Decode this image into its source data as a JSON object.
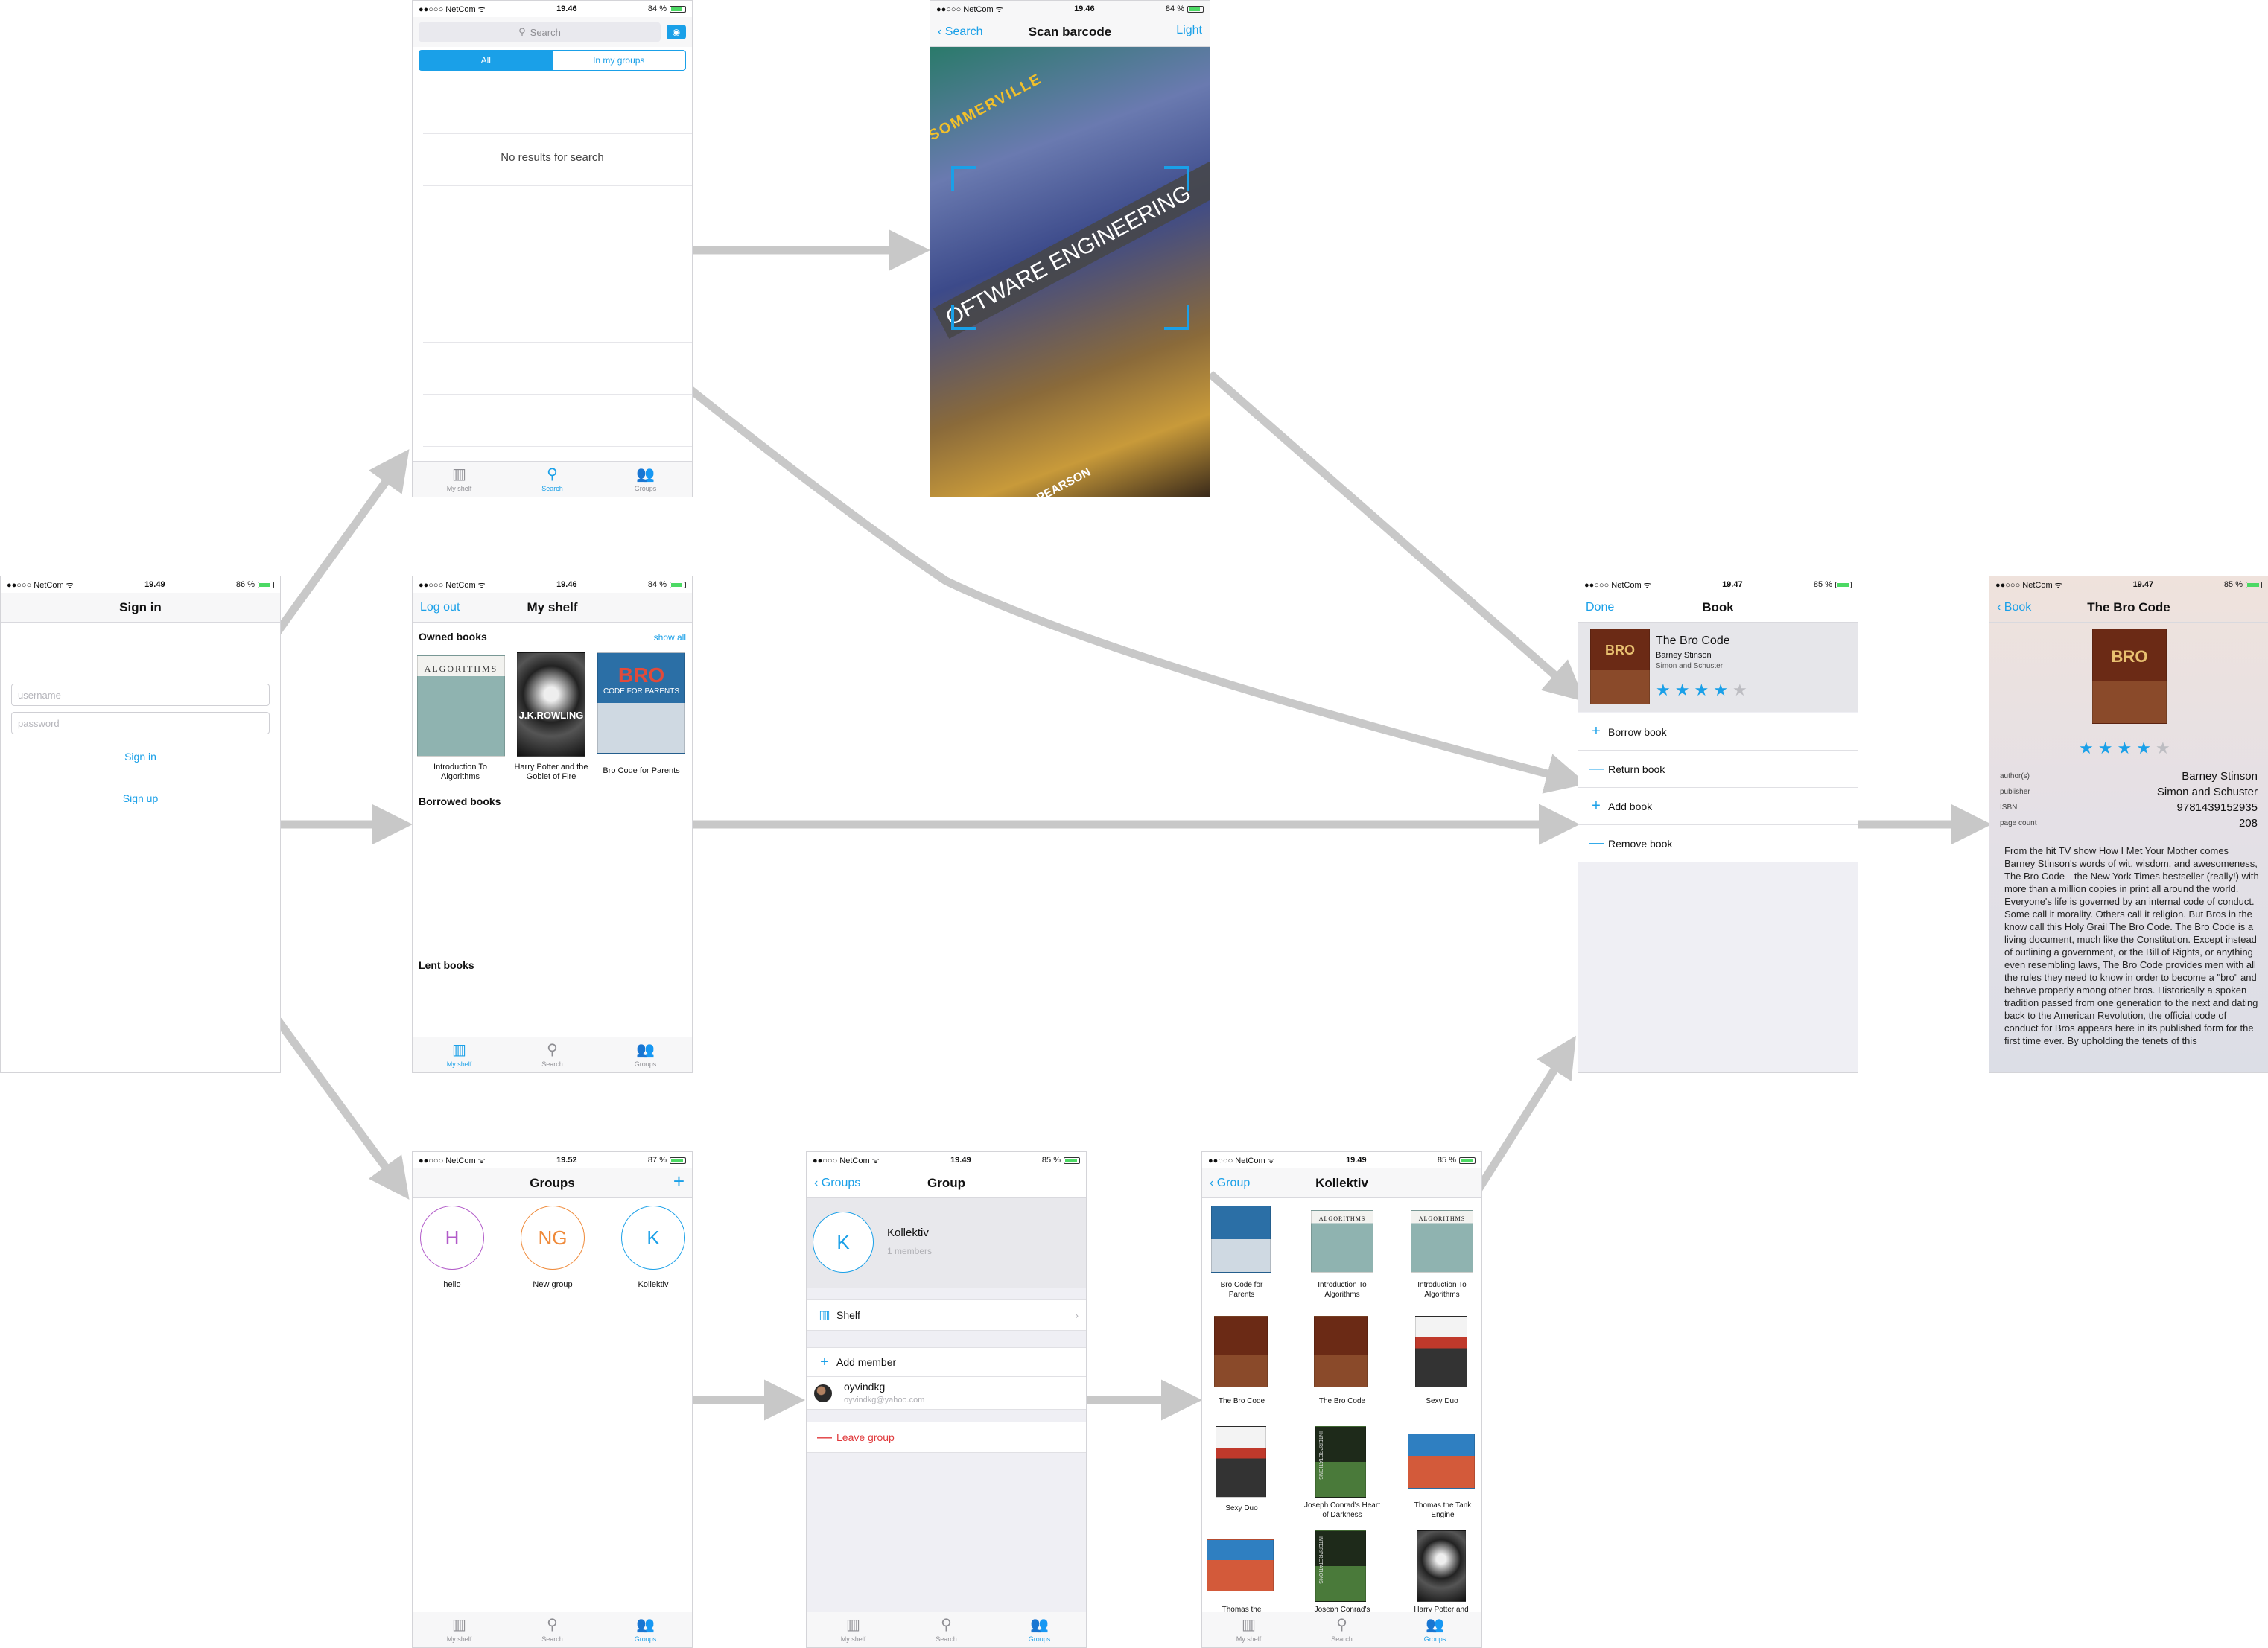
{
  "status": {
    "carrier": "NetCom",
    "t_signin": "19.49",
    "b_signin": "86 %",
    "t_search": "19.46",
    "b_search": "84 %",
    "t_scan": "19.46",
    "b_scan": "84 %",
    "t_shelf": "19.46",
    "b_shelf": "84 %",
    "t_book": "19.47",
    "b_book": "85 %",
    "t_detail": "19.47",
    "b_detail": "85 %",
    "t_groups": "19.52",
    "b_groups": "87 %",
    "t_group": "19.49",
    "b_group": "85 %",
    "t_koll": "19.49",
    "b_koll": "85 %"
  },
  "tabs": {
    "shelf": "My shelf",
    "search": "Search",
    "groups": "Groups"
  },
  "signin": {
    "title": "Sign in",
    "username_placeholder": "username",
    "password_placeholder": "password",
    "signin_label": "Sign in",
    "signup_label": "Sign up"
  },
  "search": {
    "placeholder": "Search",
    "seg_all": "All",
    "seg_groups": "In my groups",
    "empty": "No results for search"
  },
  "scan": {
    "back": "Search",
    "title": "Scan barcode",
    "right": "Light",
    "cover_top": "SOMMERVILLE",
    "cover_mid": "OFTWARE ENGINEERING",
    "cover_bottom": "PEARSON"
  },
  "shelf": {
    "left": "Log out",
    "title": "My shelf",
    "owned": "Owned books",
    "show_all": "show all",
    "borrowed": "Borrowed books",
    "lent": "Lent books",
    "books": [
      "Introduction To Algorithms",
      "Harry Potter and the Goblet of Fire",
      "Bro Code for Parents"
    ],
    "cover_algo": "ALGORITHMS",
    "cover_hp": "J.K.ROWLING",
    "cover_bro": "BRO",
    "cover_bro_sub": "CODE FOR PARENTS"
  },
  "book": {
    "left": "Done",
    "title": "Book",
    "name": "The Bro Code",
    "author": "Barney Stinson",
    "publisher": "Simon and Schuster",
    "rating": 4,
    "actions": [
      "Borrow book",
      "Return book",
      "Add book",
      "Remove book"
    ],
    "cover_word": "BRO"
  },
  "detail": {
    "back": "Book",
    "title": "The Bro Code",
    "rating": 4,
    "author_key": "author(s)",
    "author": "Barney Stinson",
    "publisher_key": "publisher",
    "publisher": "Simon and Schuster",
    "isbn_key": "ISBN",
    "isbn": "9781439152935",
    "pages_key": "page count",
    "pages": "208",
    "description": "From the hit TV show How I Met Your Mother comes Barney Stinson's words of wit, wisdom, and awesomeness, The Bro Code—the New York Times bestseller (really!) with more than a million copies in print all around the world. Everyone's life is governed by an internal code of conduct. Some call it morality. Others call it religion. But Bros in the know call this Holy Grail The Bro Code. The Bro Code is a living document, much like the Constitution. Except instead of outlining a government, or the Bill of Rights, or anything even resembling laws, The Bro Code provides men with all the rules they need to know in order to become a \"bro\" and behave properly among other bros. Historically a spoken tradition passed from one generation to the next and dating back to the American Revolution, the official code of conduct for Bros appears here in its published form for the first time ever. By upholding the tenets of this"
  },
  "groups": {
    "title": "Groups",
    "add": "+",
    "items": [
      {
        "initial": "H",
        "name": "hello",
        "color": "#b25bc9"
      },
      {
        "initial": "NG",
        "name": "New group",
        "color": "#ef8a3a"
      },
      {
        "initial": "K",
        "name": "Kollektiv",
        "color": "#1aa0e8"
      }
    ]
  },
  "group": {
    "back": "Groups",
    "title": "Group",
    "initial": "K",
    "name": "Kollektiv",
    "members": "1 members",
    "shelf": "Shelf",
    "add_member": "Add member",
    "member_name": "oyvindkg",
    "member_email": "oyvindkg@yahoo.com",
    "leave": "Leave group"
  },
  "kollektiv": {
    "back": "Group",
    "title": "Kollektiv",
    "books": [
      "Bro Code for Parents",
      "Introduction To Algorithms",
      "Introduction To Algorithms",
      "The Bro Code",
      "The Bro Code",
      "Sexy Duo",
      "Sexy Duo",
      "Joseph Conrad's Heart of Darkness",
      "Thomas the Tank Engine",
      "Thomas the",
      "Joseph Conrad's",
      "Harry Potter and"
    ],
    "cover_algo": "ALGORITHMS",
    "cover_jc": "INTERPRETATIONS"
  },
  "colors": {
    "accent": "#1aa0e8",
    "danger": "#e0383b",
    "arrow": "#c8c8c8"
  }
}
